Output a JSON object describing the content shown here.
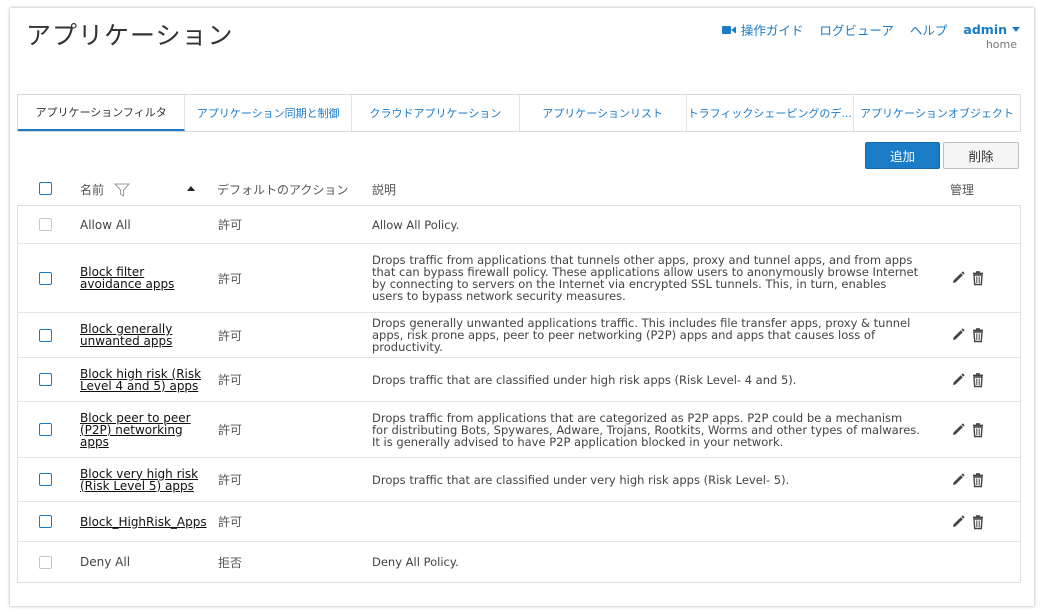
{
  "header": {
    "title": "アプリケーション",
    "subtitle": "home",
    "links": {
      "guide": "操作ガイド",
      "log_viewer": "ログビューア",
      "help": "ヘルプ",
      "admin": "admin"
    },
    "accent_color": "#1a7bc7"
  },
  "tabs": [
    {
      "label": "アプリケーションフィルタ",
      "active": true
    },
    {
      "label": "アプリケーション同期と制御",
      "active": false
    },
    {
      "label": "クラウドアプリケーション",
      "active": false
    },
    {
      "label": "アプリケーションリスト",
      "active": false
    },
    {
      "label": "トラフィックシェーピングのデ...",
      "active": false
    },
    {
      "label": "アプリケーションオブジェクト",
      "active": false
    }
  ],
  "toolbar": {
    "add_label": "追加",
    "delete_label": "削除"
  },
  "table": {
    "columns": {
      "name": "名前",
      "default_action": "デフォルトのアクション",
      "description": "説明",
      "manage": "管理"
    },
    "rows": [
      {
        "name": "Allow All",
        "action": "許可",
        "description": "Allow All Policy.",
        "link": false,
        "editable": false
      },
      {
        "name": "Block filter avoidance apps",
        "action": "許可",
        "description": "Drops traffic from applications that tunnels other apps, proxy and tunnel apps, and from apps that can bypass firewall policy. These applications allow users to anonymously browse Internet by connecting to servers on the Internet via encrypted SSL tunnels. This, in turn, enables users to bypass network security measures.",
        "link": true,
        "editable": true
      },
      {
        "name": "Block generally unwanted apps",
        "action": "許可",
        "description": "Drops generally unwanted applications traffic. This includes file transfer apps, proxy & tunnel apps, risk prone apps, peer to peer networking (P2P) apps and apps that causes loss of productivity.",
        "link": true,
        "editable": true
      },
      {
        "name": "Block high risk (Risk Level 4 and 5) apps",
        "action": "許可",
        "description": "Drops traffic that are classified under high risk apps (Risk Level- 4 and 5).",
        "link": true,
        "editable": true
      },
      {
        "name": "Block peer to peer (P2P) networking apps",
        "action": "許可",
        "description": "Drops traffic from applications that are categorized as P2P apps. P2P could be a mechanism for distributing Bots, Spywares, Adware, Trojans, Rootkits, Worms and other types of malwares. It is generally advised to have P2P application blocked in your network.",
        "link": true,
        "editable": true
      },
      {
        "name": "Block very high risk (Risk Level 5) apps",
        "action": "許可",
        "description": "Drops traffic that are classified under very high risk apps (Risk Level- 5).",
        "link": true,
        "editable": true
      },
      {
        "name": "Block_HighRisk_Apps",
        "action": "許可",
        "description": "",
        "link": true,
        "editable": true
      },
      {
        "name": "Deny All",
        "action": "拒否",
        "description": "Deny All Policy.",
        "link": false,
        "editable": false
      }
    ]
  }
}
